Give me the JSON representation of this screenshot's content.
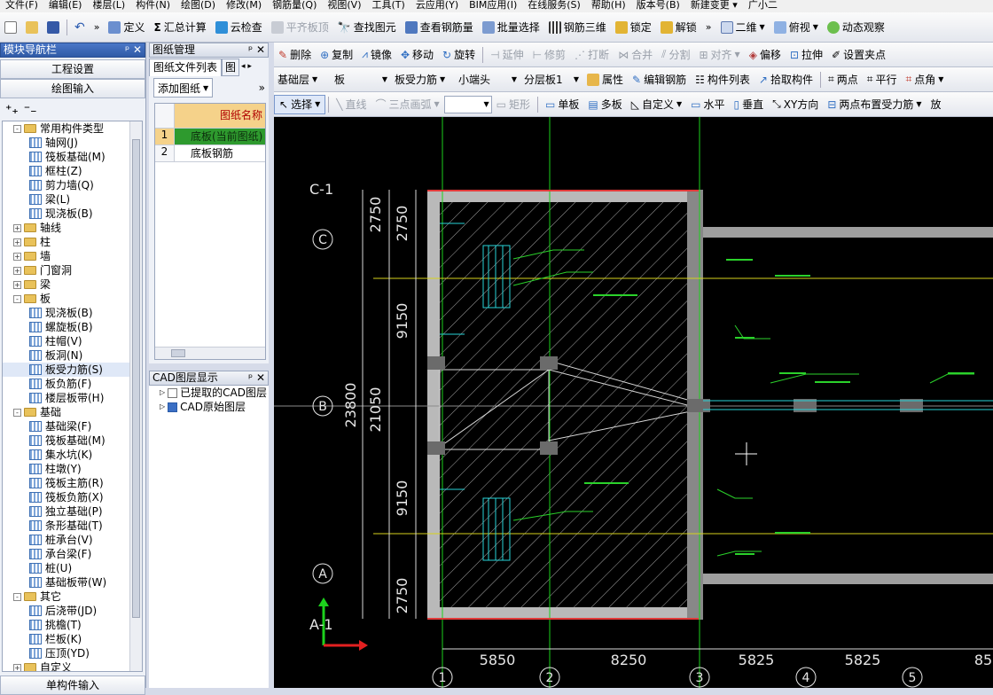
{
  "menu": [
    "文件(F)",
    "编辑(E)",
    "楼层(L)",
    "构件(N)",
    "绘图(D)",
    "修改(M)",
    "钢筋量(Q)",
    "视图(V)",
    "工具(T)",
    "云应用(Y)",
    "BIM应用(I)",
    "在线服务(S)",
    "帮助(H)",
    "版本号(B)",
    "新建变更 ▾",
    "广小二"
  ],
  "toolbar1": {
    "define": "定义",
    "sum": "汇总计算",
    "cloud_check": "云检查",
    "align_top": "平齐板顶",
    "find": "查找图元",
    "view_rebar": "查看钢筋量",
    "batch_select": "批量选择",
    "rebar_3d": "钢筋三维",
    "lock": "锁定",
    "unlock": "解锁",
    "view2d": "二维",
    "view_top": "俯视",
    "dynamic": "动态观察"
  },
  "toolbar2": {
    "delete": "删除",
    "copy": "复制",
    "mirror": "镜像",
    "move": "移动",
    "rotate": "旋转",
    "extend": "延伸",
    "trim": "修剪",
    "break": "打断",
    "merge": "合并",
    "split": "分割",
    "align": "对齐",
    "offset": "偏移",
    "stretch": "拉伸",
    "set_grip": "设置夹点"
  },
  "toolbar3": {
    "floor": "基础层",
    "cat": "板",
    "type": "板受力筋",
    "name": "小端头",
    "layer": "分层板1",
    "props": "属性",
    "edit_rebar": "编辑钢筋",
    "comp_list": "构件列表",
    "pick": "拾取构件",
    "two_point": "两点",
    "parallel": "平行",
    "angle": "点角"
  },
  "toolbar4": {
    "select": "选择",
    "line": "直线",
    "arc3": "三点画弧",
    "rect": "矩形",
    "single": "单板",
    "multi": "多板",
    "custom": "自定义",
    "horizontal": "水平",
    "vertical": "垂直",
    "xy": "XY方向",
    "two_point_rebar": "两点布置受力筋",
    "fang": "放"
  },
  "nav": {
    "title": "模块导航栏",
    "pin": "ᵖ ✕",
    "project": "工程设置",
    "drawing": "绘图输入",
    "single_input": "单构件输入",
    "tree": [
      {
        "level": 1,
        "exp": "-",
        "folder": true,
        "label": "常用构件类型"
      },
      {
        "level": 2,
        "label": "轴网(J)"
      },
      {
        "level": 2,
        "label": "筏板基础(M)"
      },
      {
        "level": 2,
        "label": "框柱(Z)"
      },
      {
        "level": 2,
        "label": "剪力墙(Q)"
      },
      {
        "level": 2,
        "label": "梁(L)"
      },
      {
        "level": 2,
        "label": "现浇板(B)"
      },
      {
        "level": 1,
        "exp": "+",
        "folder": true,
        "label": "轴线"
      },
      {
        "level": 1,
        "exp": "+",
        "folder": true,
        "label": "柱"
      },
      {
        "level": 1,
        "exp": "+",
        "folder": true,
        "label": "墙"
      },
      {
        "level": 1,
        "exp": "+",
        "folder": true,
        "label": "门窗洞"
      },
      {
        "level": 1,
        "exp": "+",
        "folder": true,
        "label": "梁"
      },
      {
        "level": 1,
        "exp": "-",
        "folder": true,
        "label": "板"
      },
      {
        "level": 2,
        "label": "现浇板(B)"
      },
      {
        "level": 2,
        "label": "螺旋板(B)"
      },
      {
        "level": 2,
        "label": "柱帽(V)"
      },
      {
        "level": 2,
        "label": "板洞(N)"
      },
      {
        "level": 2,
        "label": "板受力筋(S)",
        "selected": true
      },
      {
        "level": 2,
        "label": "板负筋(F)"
      },
      {
        "level": 2,
        "label": "楼层板带(H)"
      },
      {
        "level": 1,
        "exp": "-",
        "folder": true,
        "label": "基础"
      },
      {
        "level": 2,
        "label": "基础梁(F)"
      },
      {
        "level": 2,
        "label": "筏板基础(M)"
      },
      {
        "level": 2,
        "label": "集水坑(K)"
      },
      {
        "level": 2,
        "label": "柱墩(Y)"
      },
      {
        "level": 2,
        "label": "筏板主筋(R)"
      },
      {
        "level": 2,
        "label": "筏板负筋(X)"
      },
      {
        "level": 2,
        "label": "独立基础(P)"
      },
      {
        "level": 2,
        "label": "条形基础(T)"
      },
      {
        "level": 2,
        "label": "桩承台(V)"
      },
      {
        "level": 2,
        "label": "承台梁(F)"
      },
      {
        "level": 2,
        "label": "桩(U)"
      },
      {
        "level": 2,
        "label": "基础板带(W)"
      },
      {
        "level": 1,
        "exp": "-",
        "folder": true,
        "label": "其它"
      },
      {
        "level": 2,
        "label": "后浇带(JD)"
      },
      {
        "level": 2,
        "label": "挑檐(T)"
      },
      {
        "level": 2,
        "label": "栏板(K)"
      },
      {
        "level": 2,
        "label": "压顶(YD)"
      },
      {
        "level": 1,
        "exp": "+",
        "folder": true,
        "label": "自定义"
      }
    ]
  },
  "drawing_mgr": {
    "title": "图纸管理",
    "pin": "ᵖ ✕",
    "tab1": "图纸文件列表",
    "tab2": "图",
    "add": "添加图纸",
    "col_name": "图纸名称",
    "rows": [
      {
        "idx": "1",
        "name": "底板(当前图纸)",
        "current": true
      },
      {
        "idx": "2",
        "name": "底板钢筋",
        "current": false
      }
    ]
  },
  "cad_layers": {
    "title": "CAD图层显示",
    "pin": "ᵖ ✕",
    "items": [
      "已提取的CAD图层",
      "CAD原始图层"
    ]
  },
  "cad": {
    "axis_rows": [
      "C-1",
      "C",
      "B",
      "A-1"
    ],
    "axis_A": "A",
    "axis_cols": [
      "1",
      "2",
      "3",
      "4",
      "5"
    ],
    "dims_left_inner": [
      "2750",
      "9150",
      "9150",
      "2750"
    ],
    "dims_left_outer": [
      "2750",
      "21050"
    ],
    "total": "23800",
    "dims_bottom": [
      "5850",
      "8250",
      "5825",
      "5825",
      "85"
    ]
  }
}
